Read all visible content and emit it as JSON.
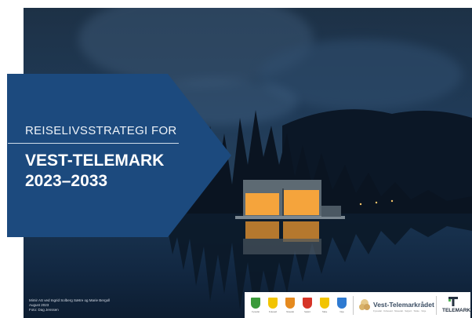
{
  "cover": {
    "subtitle": "REISELIVSSTRATEGI FOR",
    "title_line1": "VEST-TELEMARK",
    "title_line2": "2023–2033"
  },
  "credits": {
    "line1": "Mimir AS ved Ingrid Solberg Sætre og Marie Bergoll",
    "line2": "August 2023",
    "line3": "Foto: Dag Jenssen"
  },
  "logos": {
    "municipalities": [
      {
        "name": "Fyresdal",
        "color": "#3a9a3a"
      },
      {
        "name": "Kviteseid",
        "color": "#f2c400"
      },
      {
        "name": "Nissedal",
        "color": "#e58a1f"
      },
      {
        "name": "Seljord",
        "color": "#d63427"
      },
      {
        "name": "Tokke",
        "color": "#f2c400"
      },
      {
        "name": "Vinje",
        "color": "#2e7ad1"
      }
    ],
    "region_name": "Vest-Telemarkrådet",
    "region_sub": "Fyresdal · Kviteseid · Nissedal · Seljord · Tokke · Vinje",
    "county_name": "TELEMARK"
  },
  "colors": {
    "banner": "#1c4a7e",
    "window_glow": "#f5a43c"
  }
}
